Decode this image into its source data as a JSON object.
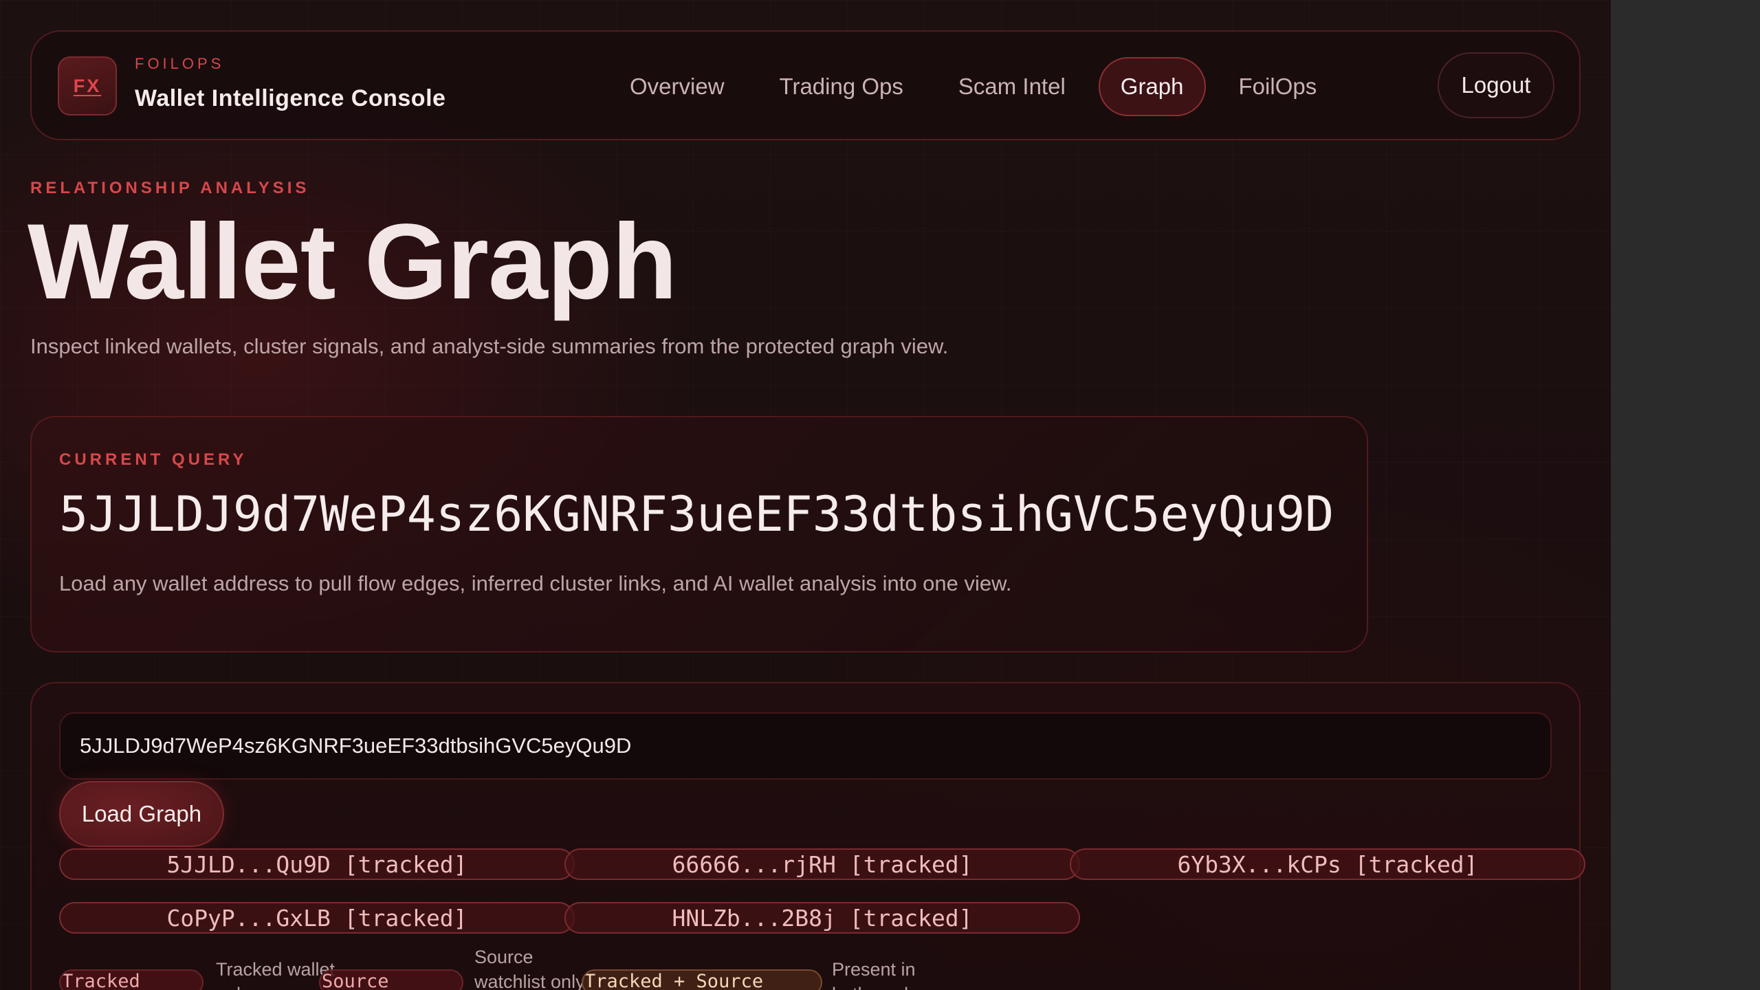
{
  "nav": {
    "logo_text": "FX",
    "brand_eyebrow": "FOILOPS",
    "brand_title": "Wallet Intelligence Console",
    "links": [
      {
        "label": "Overview"
      },
      {
        "label": "Trading Ops"
      },
      {
        "label": "Scam Intel"
      },
      {
        "label": "Graph",
        "active": true
      },
      {
        "label": "FoilOps"
      }
    ],
    "logout_label": "Logout"
  },
  "hero": {
    "eyebrow": "RELATIONSHIP ANALYSIS",
    "title": "Wallet Graph",
    "subtitle": "Inspect linked wallets, cluster signals, and analyst-side summaries from the protected graph view."
  },
  "query": {
    "eyebrow": "CURRENT QUERY",
    "address": "5JJLDJ9d7WeP4sz6KGNRF3ueEF33dtbsihGVC5eyQu9D",
    "description": "Load any wallet address to pull flow edges, inferred cluster links, and AI wallet analysis into one view."
  },
  "controls": {
    "input_value": "5JJLDJ9d7WeP4sz6KGNRF3ueEF33dtbsihGVC5eyQu9D",
    "load_label": "Load Graph",
    "chips": [
      "5JJLD...Qu9D [tracked]",
      "66666...rjRH [tracked]",
      "6Yb3X...kCPs [tracked]",
      "CoPyP...GxLB [tracked]",
      "HNLZb...2B8j [tracked]"
    ],
    "legend": [
      {
        "pill": "Tracked",
        "desc": "Tracked wallet only"
      },
      {
        "pill": "Source",
        "desc": "Source watchlist only"
      },
      {
        "pill": "Tracked + Source",
        "desc": "Present in both pools"
      }
    ]
  },
  "colors": {
    "accent": "#d8474b",
    "background": "#1a0d0e",
    "text": "#f2e6e6"
  }
}
